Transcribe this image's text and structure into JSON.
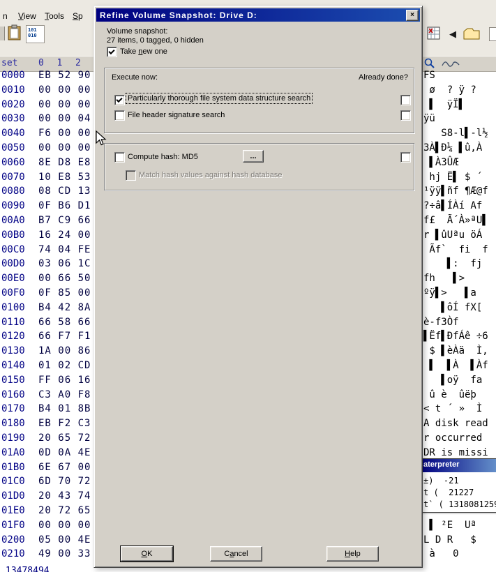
{
  "app": {
    "menu": [
      {
        "label": "n",
        "mnemonic": false
      },
      {
        "label": "View",
        "mnemonic": true
      },
      {
        "label": "Tools",
        "mnemonic": true
      },
      {
        "label": "Sp",
        "mnemonic": true
      }
    ],
    "status": "13478494",
    "icons": {
      "toolbar_left": [
        "clipboard-icon",
        "binary-convert-icon"
      ],
      "toolbar_right": [
        "calculator-icon",
        "back-arrow-icon",
        "folder-icon",
        "partial-icon"
      ],
      "header_right": [
        "magnifier-icon",
        "wave-icon"
      ]
    },
    "colors": {
      "title_bar": "#000080",
      "chrome": "#ece9e2",
      "offset_text": "#000085"
    }
  },
  "hex": {
    "offset_header": "set",
    "col_headers": "0  1  2",
    "rows": [
      {
        "o": "0000",
        "h": "EB 52 90",
        "a": "FS"
      },
      {
        "o": "0010",
        "h": "00 00 00",
        "a": " ø  ? ÿ ?"
      },
      {
        "o": "0020",
        "h": "00 00 00",
        "a": " ▌  ÿÏ▌"
      },
      {
        "o": "0030",
        "h": "00 00 04",
        "a": "ÿü"
      },
      {
        "o": "0040",
        "h": "F6 00 00",
        "a": "   S8-l▌-l½"
      },
      {
        "o": "0050",
        "h": "00 00 00",
        "a": "3À▌Ð¼ ▌û,À"
      },
      {
        "o": "0060",
        "h": "8E D8 E8",
        "a": " ▌À3ÛÆ"
      },
      {
        "o": "0070",
        "h": "10 E8 53",
        "a": " hj Ë▌ $ ´"
      },
      {
        "o": "0080",
        "h": "08 CD 13",
        "a": "¹ÿÿ▌ñf ¶Æ@f"
      },
      {
        "o": "0090",
        "h": "0F B6 D1",
        "a": "?÷â▌ÍÀí Af"
      },
      {
        "o": "00A0",
        "h": "B7 C9 66",
        "a": "f£  Ã´À»ªU▌"
      },
      {
        "o": "00B0",
        "h": "16 24 00",
        "a": "r ▌ûUªu öÁ"
      },
      {
        "o": "00C0",
        "h": "74 04 FE",
        "a": " Ãf`  fi  f"
      },
      {
        "o": "00D0",
        "h": "03 06 1C",
        "a": "    ▌:  fj"
      },
      {
        "o": "00E0",
        "h": "00 66 50",
        "a": "fh   ▌>"
      },
      {
        "o": "00F0",
        "h": "0F 85 00",
        "a": "ºÿ▌>   ▌a"
      },
      {
        "o": "0100",
        "h": "B4 42 8A",
        "a": "   ▌ôÍ fX["
      },
      {
        "o": "0110",
        "h": "66 58 66",
        "a": "è-f3Òf"
      },
      {
        "o": "0120",
        "h": "66 F7 F1",
        "a": "▌Ëf▌ÐfÁê ÷6"
      },
      {
        "o": "0130",
        "h": "1A 00 86",
        "a": " $ ▌èÀä  Ì,"
      },
      {
        "o": "0140",
        "h": "01 02 CD",
        "a": " ▌  ▌À  ▌Àf"
      },
      {
        "o": "0150",
        "h": "FF 06 16",
        "a": "   ▌oÿ  fa"
      },
      {
        "o": "0160",
        "h": "C3 A0 F8",
        "a": " û è  ûëþ"
      },
      {
        "o": "0170",
        "h": "B4 01 8B",
        "a": "< t ´ »  Ì"
      },
      {
        "o": "0180",
        "h": "EB F2 C3",
        "a": "A disk read"
      },
      {
        "o": "0190",
        "h": "20 65 72",
        "a": "r occurred "
      },
      {
        "o": "01A0",
        "h": "0D 0A 4E",
        "a": "DR is missi"
      },
      {
        "o": "01B0",
        "h": "6E 67 00",
        "a": ""
      },
      {
        "o": "01C0",
        "h": "6D 70 72",
        "a": ""
      },
      {
        "o": "01D0",
        "h": "20 43 74",
        "a": ""
      },
      {
        "o": "01E0",
        "h": "20 72 65",
        "a": ""
      },
      {
        "o": "01F0",
        "h": "00 00 00",
        "a": " ▌ ²E  Uª"
      },
      {
        "o": "0200",
        "h": "05 00 4E",
        "a": "L D R   $"
      },
      {
        "o": "0210",
        "h": "49 00 33",
        "a": " à   0"
      }
    ]
  },
  "interpreter": {
    "title": "aterpreter",
    "rows": [
      "±)  -21",
      "t (  21227",
      "t` ( 1318081259"
    ]
  },
  "dialog": {
    "title": "Refine Volume Snapshot: Drive D:",
    "close": "×",
    "snapshot_label": "Volume snapshot:",
    "snapshot_stats": "27 items, 0 tagged, 0 hidden",
    "take_new": {
      "pre": "Take ",
      "key": "n",
      "rest": "ew one",
      "checked": true
    },
    "execute_now": "Execute now:",
    "already_done": "Already done?",
    "opt1": {
      "label": "Particularly thorough file system data structure search",
      "checked": true,
      "already_done_checked": false
    },
    "opt2": {
      "label": "File header signature search",
      "checked": false,
      "already_done_checked": false
    },
    "hash": {
      "label": "Compute hash: MD5",
      "checked": false,
      "browse": "...",
      "already_done_checked": false
    },
    "hash_match": {
      "label": "Match hash values against hash database",
      "checked": false,
      "disabled": true
    },
    "buttons": {
      "ok": {
        "key": "O",
        "rest": "K"
      },
      "cancel": {
        "pre": "C",
        "key": "a",
        "rest": "ncel"
      },
      "help": {
        "key": "H",
        "rest": "elp"
      }
    }
  }
}
